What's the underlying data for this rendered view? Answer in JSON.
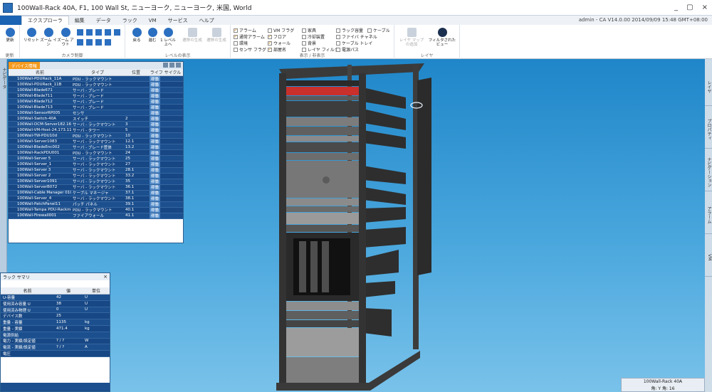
{
  "window": {
    "title": "100Wall-Rack 40A, F1, 100 Wall St, ニューヨーク, ニューヨーク, 米国, World",
    "controls": [
      "_",
      "▢",
      "×"
    ]
  },
  "ribbon": {
    "file_tab": "",
    "tabs": [
      "エクスプローラ",
      "編集",
      "データ",
      "ラック",
      "VM",
      "サービス",
      "ヘルプ"
    ],
    "active_tab": "エクスプローラ",
    "user_status": "admin - CA V14.0.00        2014/09/09 15:48 GMT+08:00",
    "groups": {
      "update": {
        "label": "更新",
        "buttons": [
          "更新"
        ]
      },
      "camera": {
        "label": "カメラ制御",
        "buttons": [
          "リセット",
          "ズーム イン",
          "ズーム アウト"
        ]
      },
      "level": {
        "label": "レベルの表示",
        "buttons": [
          "戻る",
          "進む",
          "1 レベル 上へ",
          "遷移の生成",
          "遷移の生成"
        ]
      },
      "view": {
        "label": "表示 / 非表示",
        "checks": [
          {
            "label": "アラーム",
            "checked": true
          },
          {
            "label": "通常アラーム",
            "checked": true
          },
          {
            "label": "環境",
            "checked": false
          },
          {
            "label": "センサ フラグ",
            "checked": false
          },
          {
            "label": "VM フラグ",
            "checked": false
          },
          {
            "label": "フロア",
            "checked": true
          },
          {
            "label": "ウォール",
            "checked": true
          },
          {
            "label": "部屋名",
            "checked": true
          },
          {
            "label": "家具",
            "checked": false
          },
          {
            "label": "冷却装置",
            "checked": false
          },
          {
            "label": "背景",
            "checked": false
          },
          {
            "label": "レイヤ フィルタ",
            "checked": false
          },
          {
            "label": "ラック容量",
            "checked": false
          },
          {
            "label": "ファイバ チャネル",
            "checked": false
          },
          {
            "label": "ケーブル トレイ",
            "checked": false
          },
          {
            "label": "電源パス",
            "checked": false
          },
          {
            "label": "ケーブル",
            "checked": false
          }
        ]
      },
      "layer": {
        "label": "レイヤ",
        "buttons": [
          "レイヤ マップ の追加",
          "フィルタされたビュー"
        ]
      }
    }
  },
  "left_strip": {
    "label": "ナビゲータ"
  },
  "right_strip": {
    "tabs": [
      "レイヤ",
      "プロパティ",
      "ナビゲーション",
      "アラーム",
      "VM"
    ]
  },
  "device_panel": {
    "tab": "デバイス情報",
    "columns": [
      "名前",
      "タイプ",
      "位置",
      "ライフ サイクル"
    ],
    "rows": [
      [
        "100Wall-PDURack_11A",
        "PDU - ラックマウント",
        "",
        "稼働"
      ],
      [
        "100Wall-PDURack_11B",
        "PDU - ラックマウント",
        "",
        "稼働"
      ],
      [
        "100Wall-Blade671",
        "サーバ - ブレード",
        "",
        "稼働"
      ],
      [
        "100Wall-Blade711",
        "サーバ - ブレード",
        "",
        "稼働"
      ],
      [
        "100Wall-Blade712",
        "サーバ - ブレード",
        "",
        "稼働"
      ],
      [
        "100Wall-Blade713",
        "サーバ - ブレード",
        "",
        "稼働"
      ],
      [
        "100Wall-SensorRP005",
        "センサ",
        "",
        "稼働"
      ],
      [
        "100Wall-Switch-40A",
        "スイッチ",
        "2",
        "稼働"
      ],
      [
        "100Wall-DCM-Server182.168.0.",
        "サーバ - ラックマウント",
        "3",
        "稼働"
      ],
      [
        "100Wall-VM-Host-24.173.119.2",
        "サーバ - タワー",
        "5",
        "稼働"
      ],
      [
        "100Wall-TW-PDU10d",
        "PDU - ラックマウント",
        "10",
        "稼働"
      ],
      [
        "100Wall-Server1083",
        "サーバ - ラックマウント",
        "12.1",
        "稼働"
      ],
      [
        "100Wall-BladeEnc002",
        "サーバ - ブレード筐体",
        "13.2",
        "稼働"
      ],
      [
        "100Wall-RackPDU001",
        "PDU - ラックマウント",
        "24",
        "稼働"
      ],
      [
        "100Wall-Server 5",
        "サーバ - ラックマウント",
        "25",
        "稼働"
      ],
      [
        "100Wall-Server_1",
        "サーバ - ラックマウント",
        "27",
        "稼働"
      ],
      [
        "100Wall-Server 3",
        "サーバ - ラックマウント",
        "28.1",
        "稼働"
      ],
      [
        "100Wall-Server 2",
        "サーバ - ラックマウント",
        "33.2",
        "稼働"
      ],
      [
        "100Wall-Server1091",
        "サーバ - ラックマウント",
        "35",
        "稼働"
      ],
      [
        "100Wall-ServerB072",
        "サーバ - ラックマウント",
        "36.1",
        "稼働"
      ],
      [
        "100Wall-Cable Manager 01U",
        "ケーブル マネージャ",
        "37.1",
        "稼働"
      ],
      [
        "100Wall-Server_4",
        "サーバ - ラックマウント",
        "38.1",
        "稼働"
      ],
      [
        "100Wall-PatchPanel11",
        "パッチ パネル",
        "39.1",
        "稼働"
      ],
      [
        "100Wall-Tampa PDU-Rackmou",
        "PDU - ラックマウント",
        "40.1",
        "稼働"
      ],
      [
        "100Wall-Firewall001",
        "ファイアウォール",
        "41.1",
        "稼働"
      ]
    ]
  },
  "rack_panel": {
    "title": "ラック サマリ",
    "columns": [
      "名前",
      "値",
      "単位"
    ],
    "rows": [
      [
        "U-容量",
        "42",
        "U"
      ],
      [
        "使用済み容量 U",
        "38",
        "U"
      ],
      [
        "使用済み物理 U",
        "0",
        "U"
      ],
      [
        "デバイス数",
        "25",
        ""
      ],
      [
        "重量 - 容量",
        "1135",
        "kg"
      ],
      [
        "重量 - 実績",
        "471.4",
        "kg"
      ],
      [
        "電源供給",
        "",
        ""
      ],
      [
        "電力 - 実績/設定値",
        "? / ?",
        "W"
      ],
      [
        "電流 - 実績/設定値",
        "? / ?",
        "A"
      ],
      [
        "電圧",
        "",
        ""
      ]
    ]
  },
  "info_box": {
    "line1": "100Wall-Rack 40A",
    "line2": "角: Y  角: 16"
  }
}
